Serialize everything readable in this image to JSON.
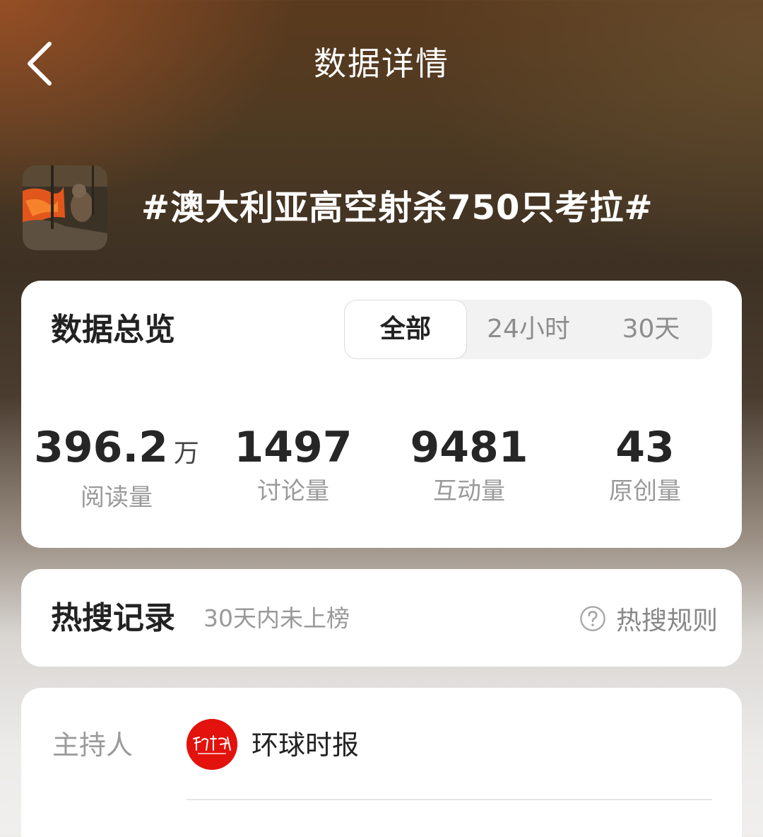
{
  "header": {
    "title": "数据详情",
    "back_icon": "chevron-left-icon"
  },
  "topic": {
    "title": "#澳大利亚高空射杀750只考拉#"
  },
  "overview": {
    "title": "数据总览",
    "tabs": [
      {
        "label": "全部",
        "active": true
      },
      {
        "label": "24小时",
        "active": false
      },
      {
        "label": "30天",
        "active": false
      }
    ],
    "stats": [
      {
        "value": "396.2",
        "unit": "万",
        "label": "阅读量"
      },
      {
        "value": "1497",
        "unit": "",
        "label": "讨论量"
      },
      {
        "value": "9481",
        "unit": "",
        "label": "互动量"
      },
      {
        "value": "43",
        "unit": "",
        "label": "原创量"
      }
    ]
  },
  "hot_search": {
    "title": "热搜记录",
    "subtitle": "30天内未上榜",
    "rules_label": "热搜规则",
    "rules_icon": "question-circle-icon"
  },
  "host": {
    "label": "主持人",
    "name": "环球时报"
  },
  "colors": {
    "card_bg": "#ffffff",
    "avatar_red": "#e3120c",
    "text_primary": "#222222",
    "text_secondary": "#9a9a9a"
  }
}
